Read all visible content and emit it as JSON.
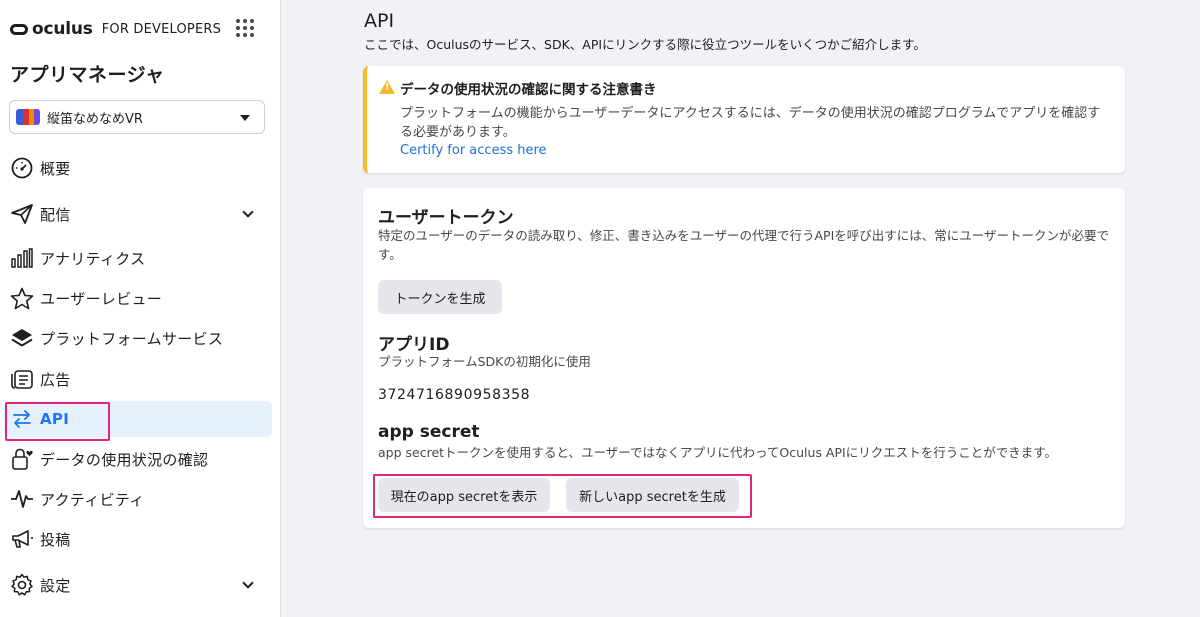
{
  "brand": {
    "name": "oculus",
    "subtitle": "FOR DEVELOPERS"
  },
  "sidebar": {
    "title": "アプリマネージャ",
    "app_selector": {
      "value": "縦笛なめなめVR"
    },
    "items": [
      {
        "label": "概要",
        "icon": "dashboard-gauge-icon"
      },
      {
        "label": "配信",
        "icon": "paper-plane-icon",
        "expandable": true
      },
      {
        "label": "アナリティクス",
        "icon": "bar-chart-icon"
      },
      {
        "label": "ユーザーレビュー",
        "icon": "star-icon"
      },
      {
        "label": "プラットフォームサービス",
        "icon": "layers-icon"
      },
      {
        "label": "広告",
        "icon": "ads-icon"
      },
      {
        "label": "API",
        "icon": "swap-arrows-icon",
        "active": true
      },
      {
        "label": "データの使用状況の確認",
        "icon": "lock-heart-icon"
      },
      {
        "label": "アクティビティ",
        "icon": "activity-pulse-icon"
      },
      {
        "label": "投稿",
        "icon": "megaphone-icon"
      },
      {
        "label": "設定",
        "icon": "gear-icon",
        "expandable": true
      }
    ]
  },
  "main": {
    "title": "API",
    "description": "ここでは、Oculusのサービス、SDK、APIにリンクする際に役立つツールをいくつかご紹介します。",
    "notice": {
      "title": "データの使用状況の確認に関する注意書き",
      "body": "プラットフォームの機能からユーザーデータにアクセスするには、データの使用状況の確認プログラムでアプリを確認する必要があります。",
      "link": "Certify for access here"
    },
    "user_token": {
      "title": "ユーザートークン",
      "description": "特定のユーザーのデータの読み取り、修正、書き込みをユーザーの代理で行うAPIを呼び出すには、常にユーザートークンが必要です。",
      "button": "トークンを生成"
    },
    "app_id": {
      "title": "アプリID",
      "description": "プラットフォームSDKの初期化に使用",
      "value": "3724716890958358"
    },
    "app_secret": {
      "title": "app secret",
      "description": "app secretトークンを使用すると、ユーザーではなくアプリに代わってOculus APIにリクエストを行うことができます。",
      "show_button": "現在のapp secretを表示",
      "generate_button": "新しいapp secretを生成"
    }
  },
  "colors": {
    "accent": "#1877f2",
    "warning": "#f7b928",
    "highlight": "#e0257a",
    "link": "#216fdb"
  }
}
